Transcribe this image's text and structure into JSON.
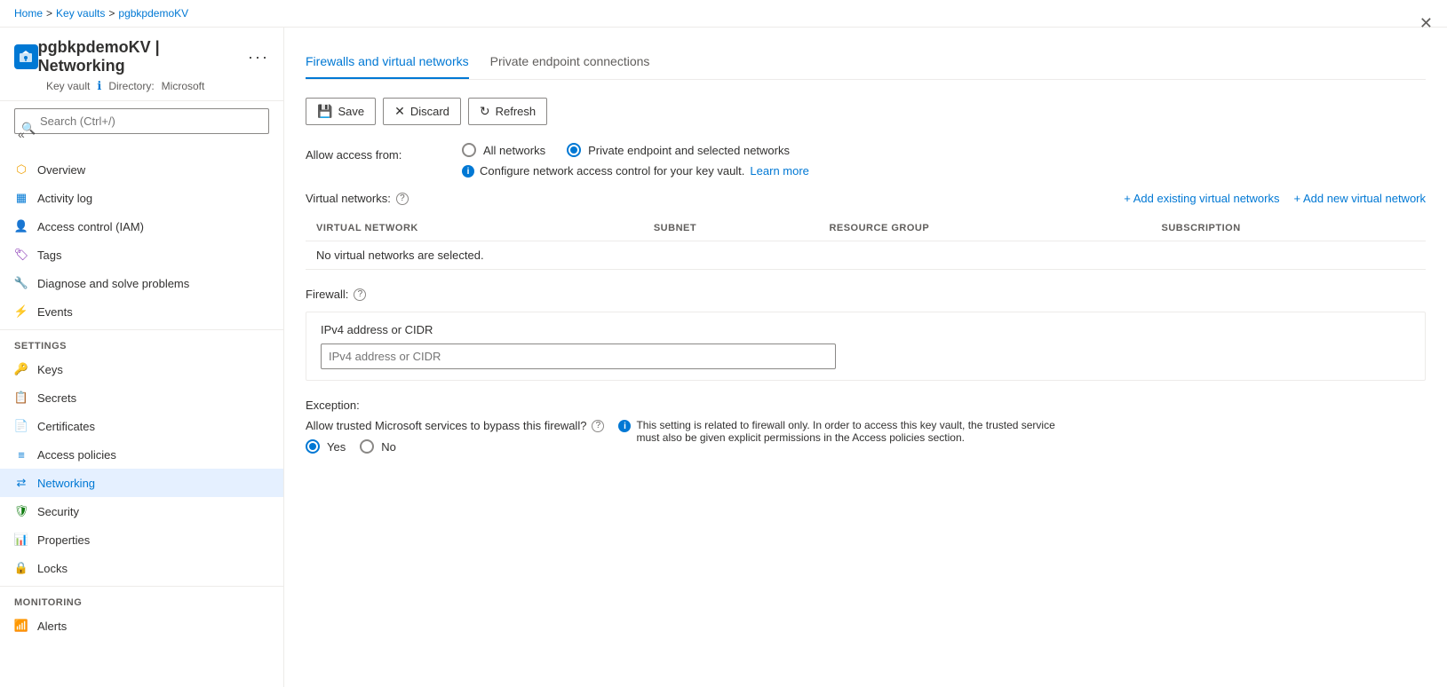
{
  "breadcrumb": {
    "items": [
      "Home",
      "Key vaults",
      "pgbkpdemoKV"
    ]
  },
  "resource": {
    "name": "pgbkpdemoKV",
    "page_title": "pgbkpdemoKV | Networking",
    "type": "Key vault",
    "directory_label": "Directory:",
    "directory_value": "Microsoft"
  },
  "search": {
    "placeholder": "Search (Ctrl+/)"
  },
  "nav": {
    "items": [
      {
        "id": "overview",
        "label": "Overview",
        "icon": "overview"
      },
      {
        "id": "activity-log",
        "label": "Activity log",
        "icon": "activity"
      },
      {
        "id": "access-control",
        "label": "Access control (IAM)",
        "icon": "iam"
      },
      {
        "id": "tags",
        "label": "Tags",
        "icon": "tags"
      },
      {
        "id": "diagnose",
        "label": "Diagnose and solve problems",
        "icon": "diagnose"
      },
      {
        "id": "events",
        "label": "Events",
        "icon": "events"
      }
    ],
    "settings_section": "Settings",
    "settings_items": [
      {
        "id": "keys",
        "label": "Keys",
        "icon": "keys"
      },
      {
        "id": "secrets",
        "label": "Secrets",
        "icon": "secrets"
      },
      {
        "id": "certificates",
        "label": "Certificates",
        "icon": "certificates"
      },
      {
        "id": "access-policies",
        "label": "Access policies",
        "icon": "policies"
      },
      {
        "id": "networking",
        "label": "Networking",
        "icon": "networking",
        "active": true
      },
      {
        "id": "security",
        "label": "Security",
        "icon": "security"
      },
      {
        "id": "properties",
        "label": "Properties",
        "icon": "properties"
      },
      {
        "id": "locks",
        "label": "Locks",
        "icon": "locks"
      }
    ],
    "monitoring_section": "Monitoring",
    "monitoring_items": [
      {
        "id": "alerts",
        "label": "Alerts",
        "icon": "alerts"
      }
    ]
  },
  "tabs": [
    {
      "id": "firewalls",
      "label": "Firewalls and virtual networks",
      "active": true
    },
    {
      "id": "private-endpoint",
      "label": "Private endpoint connections",
      "active": false
    }
  ],
  "toolbar": {
    "save_label": "Save",
    "discard_label": "Discard",
    "refresh_label": "Refresh"
  },
  "allow_access": {
    "label": "Allow access from:",
    "options": [
      {
        "id": "all-networks",
        "label": "All networks",
        "selected": false
      },
      {
        "id": "private-endpoint",
        "label": "Private endpoint and selected networks",
        "selected": true
      }
    ],
    "info_text": "Configure network access control for your key vault.",
    "learn_more": "Learn more"
  },
  "virtual_networks": {
    "label": "Virtual networks:",
    "add_existing": "+ Add existing virtual networks",
    "add_new": "+ Add new virtual network",
    "columns": [
      "VIRTUAL NETWORK",
      "SUBNET",
      "RESOURCE GROUP",
      "SUBSCRIPTION"
    ],
    "empty_text": "No virtual networks are selected."
  },
  "firewall": {
    "label": "Firewall:",
    "ipv4_title": "IPv4 address or CIDR",
    "ipv4_placeholder": "IPv4 address or CIDR"
  },
  "exception": {
    "label": "Exception:",
    "question": "Allow trusted Microsoft services to bypass this firewall?",
    "options": [
      {
        "id": "yes",
        "label": "Yes",
        "selected": true
      },
      {
        "id": "no",
        "label": "No",
        "selected": false
      }
    ],
    "info_text": "This setting is related to firewall only. In order to access this key vault, the trusted service must also be given explicit permissions in the Access policies section."
  }
}
